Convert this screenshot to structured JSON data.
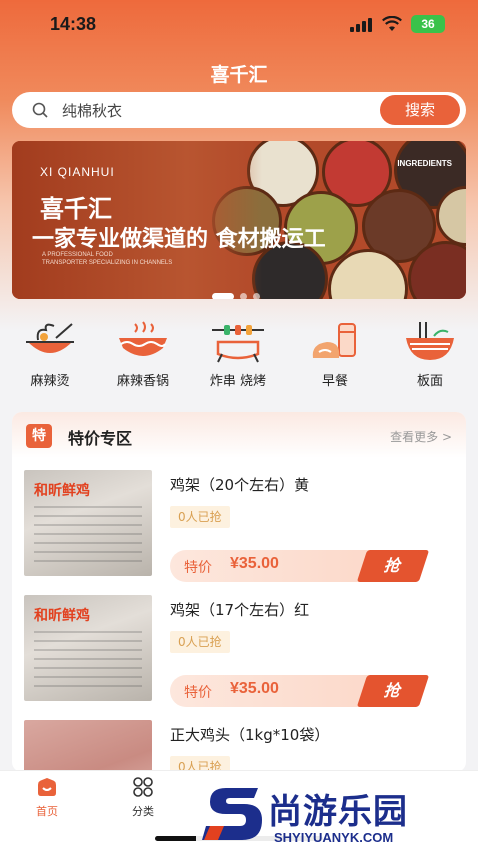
{
  "status_bar": {
    "time": "14:38",
    "battery": "36"
  },
  "app": {
    "title": "喜千汇"
  },
  "search": {
    "placeholder": "纯棉秋衣",
    "button": "搜索"
  },
  "banner": {
    "brand_en": "XI QIANHUI",
    "brand_cn": "喜千汇",
    "slogan": "一家专业做渠道的   食材搬运工",
    "sub_line1": "A PROFESSIONAL FOOD",
    "sub_line2": "TRANSPORTER SPECIALIZING IN CHANNELS",
    "tag": "INGREDIENTS",
    "pages": 3,
    "active_page": 1
  },
  "categories": [
    {
      "label": "麻辣烫",
      "icon": "hotpot-bowl-icon"
    },
    {
      "label": "麻辣香锅",
      "icon": "spicy-pot-icon"
    },
    {
      "label": "炸串 烧烤",
      "icon": "skewer-grill-icon"
    },
    {
      "label": "早餐",
      "icon": "breakfast-icon"
    },
    {
      "label": "板面",
      "icon": "noodle-bowl-icon"
    }
  ],
  "deals": {
    "badge": "特",
    "title": "特价专区",
    "see_more": "查看更多 >",
    "items": [
      {
        "name": "鸡架（20个左右）黄",
        "sold": "0人已抢",
        "price_label": "特价",
        "price": "¥35.00",
        "button": "抢",
        "thumb_brand": "和昕鲜鸡"
      },
      {
        "name": "鸡架（17个左右）红",
        "sold": "0人已抢",
        "price_label": "特价",
        "price": "¥35.00",
        "button": "抢",
        "thumb_brand": "和昕鲜鸡"
      },
      {
        "name": "正大鸡头（1kg*10袋）",
        "sold": "0人已抢",
        "price_label": "",
        "price": "",
        "button": "",
        "thumb_brand": ""
      }
    ]
  },
  "tabbar": [
    {
      "label": "首页",
      "icon": "home-icon",
      "active": true
    },
    {
      "label": "分类",
      "icon": "category-grid-icon",
      "active": false
    }
  ],
  "watermark": {
    "cn": "尚游乐园",
    "en": "SHYIYUANYK.COM"
  },
  "colors": {
    "accent": "#e9623a",
    "sold_text": "#d9a052",
    "watermark": "#1c2e8c"
  }
}
